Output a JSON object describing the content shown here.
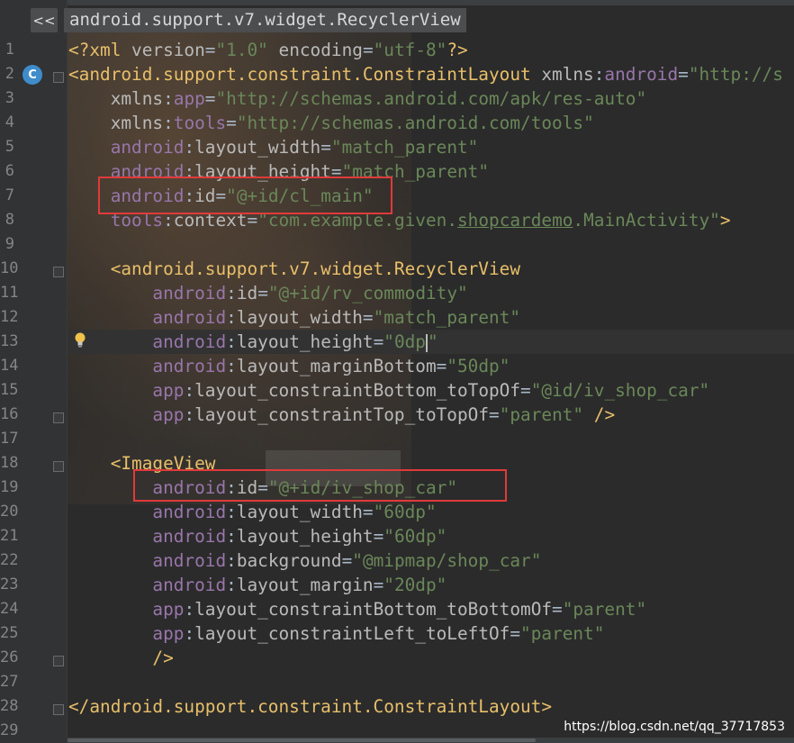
{
  "breadcrumb": {
    "back_label": "<<",
    "path": "android.support.v7.widget.RecyclerView"
  },
  "gutter_markers": {
    "class_icon": "C"
  },
  "code_lines": [
    {
      "n": "1",
      "segs": [
        [
          "t",
          "<?xml "
        ],
        [
          "an",
          "version"
        ],
        [
          "",
          "="
        ],
        [
          "av",
          "\"1.0\""
        ],
        [
          "",
          " "
        ],
        [
          "an",
          "encoding"
        ],
        [
          "",
          "="
        ],
        [
          "av",
          "\"utf-8\""
        ],
        [
          "t",
          "?>"
        ]
      ]
    },
    {
      "n": "2",
      "segs": [
        [
          "t",
          "<android.support.constraint.ConstraintLayout "
        ],
        [
          "an",
          "xmlns"
        ],
        [
          "",
          ":"
        ],
        [
          "ns",
          "android"
        ],
        [
          "",
          "="
        ],
        [
          "av",
          "\"http://s"
        ]
      ]
    },
    {
      "n": "3",
      "segs": [
        [
          "",
          "    "
        ],
        [
          "an",
          "xmlns"
        ],
        [
          "",
          ":"
        ],
        [
          "ns",
          "app"
        ],
        [
          "",
          "="
        ],
        [
          "av",
          "\"http://schemas.android.com/apk/res-auto\""
        ]
      ]
    },
    {
      "n": "4",
      "segs": [
        [
          "",
          "    "
        ],
        [
          "an",
          "xmlns"
        ],
        [
          "",
          ":"
        ],
        [
          "ns",
          "tools"
        ],
        [
          "",
          "="
        ],
        [
          "av",
          "\"http://schemas.android.com/tools\""
        ]
      ]
    },
    {
      "n": "5",
      "segs": [
        [
          "",
          "    "
        ],
        [
          "ns",
          "android"
        ],
        [
          "",
          ":"
        ],
        [
          "an",
          "layout_width"
        ],
        [
          "",
          "="
        ],
        [
          "av",
          "\"match_parent\""
        ]
      ]
    },
    {
      "n": "6",
      "segs": [
        [
          "",
          "    "
        ],
        [
          "ns",
          "android"
        ],
        [
          "",
          ":"
        ],
        [
          "an",
          "layout_height"
        ],
        [
          "",
          "="
        ],
        [
          "av",
          "\"match_parent\""
        ]
      ]
    },
    {
      "n": "7",
      "segs": [
        [
          "",
          "    "
        ],
        [
          "ns",
          "android"
        ],
        [
          "",
          ":"
        ],
        [
          "an",
          "id"
        ],
        [
          "",
          "="
        ],
        [
          "av",
          "\"@+id/cl_main\""
        ]
      ]
    },
    {
      "n": "8",
      "segs": [
        [
          "",
          "    "
        ],
        [
          "ns",
          "tools"
        ],
        [
          "",
          ":"
        ],
        [
          "an",
          "context"
        ],
        [
          "",
          "="
        ],
        [
          "av",
          "\"com.example.given."
        ],
        [
          "avu",
          "shopcardemo"
        ],
        [
          "av",
          ".MainActivity\""
        ],
        [
          "t",
          ">"
        ]
      ]
    },
    {
      "n": "9",
      "segs": []
    },
    {
      "n": "10",
      "segs": [
        [
          "",
          "    "
        ],
        [
          "t",
          "<android.support.v7.widget.RecyclerView"
        ]
      ]
    },
    {
      "n": "11",
      "segs": [
        [
          "",
          "        "
        ],
        [
          "ns",
          "android"
        ],
        [
          "",
          ":"
        ],
        [
          "an",
          "id"
        ],
        [
          "",
          "="
        ],
        [
          "av",
          "\"@+id/rv_commodity\""
        ]
      ]
    },
    {
      "n": "12",
      "segs": [
        [
          "",
          "        "
        ],
        [
          "ns",
          "android"
        ],
        [
          "",
          ":"
        ],
        [
          "an",
          "layout_width"
        ],
        [
          "",
          "="
        ],
        [
          "av",
          "\"match_parent\""
        ]
      ]
    },
    {
      "n": "13",
      "segs": [
        [
          "",
          "        "
        ],
        [
          "ns",
          "android"
        ],
        [
          "",
          ":"
        ],
        [
          "an",
          "layout_height"
        ],
        [
          "",
          "="
        ],
        [
          "av",
          "\"0dp"
        ],
        [
          "caret",
          ""
        ],
        [
          "av",
          "\""
        ]
      ]
    },
    {
      "n": "14",
      "segs": [
        [
          "",
          "        "
        ],
        [
          "ns",
          "android"
        ],
        [
          "",
          ":"
        ],
        [
          "an",
          "layout_marginBottom"
        ],
        [
          "",
          "="
        ],
        [
          "av",
          "\"50dp\""
        ]
      ]
    },
    {
      "n": "15",
      "segs": [
        [
          "",
          "        "
        ],
        [
          "ns",
          "app"
        ],
        [
          "",
          ":"
        ],
        [
          "an",
          "layout_constraintBottom_toTopOf"
        ],
        [
          "",
          "="
        ],
        [
          "av",
          "\"@id/iv_shop_car\""
        ]
      ]
    },
    {
      "n": "16",
      "segs": [
        [
          "",
          "        "
        ],
        [
          "ns",
          "app"
        ],
        [
          "",
          ":"
        ],
        [
          "an",
          "layout_constraintTop_toTopOf"
        ],
        [
          "",
          "="
        ],
        [
          "av",
          "\"parent\""
        ],
        [
          "",
          " "
        ],
        [
          "t",
          "/>"
        ]
      ]
    },
    {
      "n": "17",
      "segs": []
    },
    {
      "n": "18",
      "segs": [
        [
          "",
          "    "
        ],
        [
          "t",
          "<ImageView"
        ]
      ]
    },
    {
      "n": "19",
      "segs": [
        [
          "",
          "        "
        ],
        [
          "ns",
          "android"
        ],
        [
          "",
          ":"
        ],
        [
          "an",
          "id"
        ],
        [
          "",
          "="
        ],
        [
          "av",
          "\"@+id/iv_shop_car\""
        ]
      ]
    },
    {
      "n": "20",
      "segs": [
        [
          "",
          "        "
        ],
        [
          "ns",
          "android"
        ],
        [
          "",
          ":"
        ],
        [
          "an",
          "layout_width"
        ],
        [
          "",
          "="
        ],
        [
          "av",
          "\"60dp\""
        ]
      ]
    },
    {
      "n": "21",
      "segs": [
        [
          "",
          "        "
        ],
        [
          "ns",
          "android"
        ],
        [
          "",
          ":"
        ],
        [
          "an",
          "layout_height"
        ],
        [
          "",
          "="
        ],
        [
          "av",
          "\"60dp\""
        ]
      ]
    },
    {
      "n": "22",
      "segs": [
        [
          "",
          "        "
        ],
        [
          "ns",
          "android"
        ],
        [
          "",
          ":"
        ],
        [
          "an",
          "background"
        ],
        [
          "",
          "="
        ],
        [
          "av",
          "\"@mipmap/shop_car\""
        ]
      ]
    },
    {
      "n": "23",
      "segs": [
        [
          "",
          "        "
        ],
        [
          "ns",
          "android"
        ],
        [
          "",
          ":"
        ],
        [
          "an",
          "layout_margin"
        ],
        [
          "",
          "="
        ],
        [
          "av",
          "\"20dp\""
        ]
      ]
    },
    {
      "n": "24",
      "segs": [
        [
          "",
          "        "
        ],
        [
          "ns",
          "app"
        ],
        [
          "",
          ":"
        ],
        [
          "an",
          "layout_constraintBottom_toBottomOf"
        ],
        [
          "",
          "="
        ],
        [
          "av",
          "\"parent\""
        ]
      ]
    },
    {
      "n": "25",
      "segs": [
        [
          "",
          "        "
        ],
        [
          "ns",
          "app"
        ],
        [
          "",
          ":"
        ],
        [
          "an",
          "layout_constraintLeft_toLeftOf"
        ],
        [
          "",
          "="
        ],
        [
          "av",
          "\"parent\""
        ]
      ]
    },
    {
      "n": "26",
      "segs": [
        [
          "",
          "        "
        ],
        [
          "t",
          "/>"
        ]
      ]
    },
    {
      "n": "27",
      "segs": []
    },
    {
      "n": "28",
      "segs": [
        [
          "t",
          "</android.support.constraint.ConstraintLayout>"
        ]
      ]
    },
    {
      "n": "29",
      "segs": []
    }
  ],
  "watermark": "https://blog.csdn.net/qq_37717853",
  "colors": {
    "background": "#2b2b2b",
    "gutter": "#313335",
    "tag": "#e8bf6a",
    "attribute_name": "#bababa",
    "namespace": "#9876aa",
    "attribute_value": "#6a8759",
    "highlight_box": "#e03a3a",
    "line_number": "#858585"
  }
}
